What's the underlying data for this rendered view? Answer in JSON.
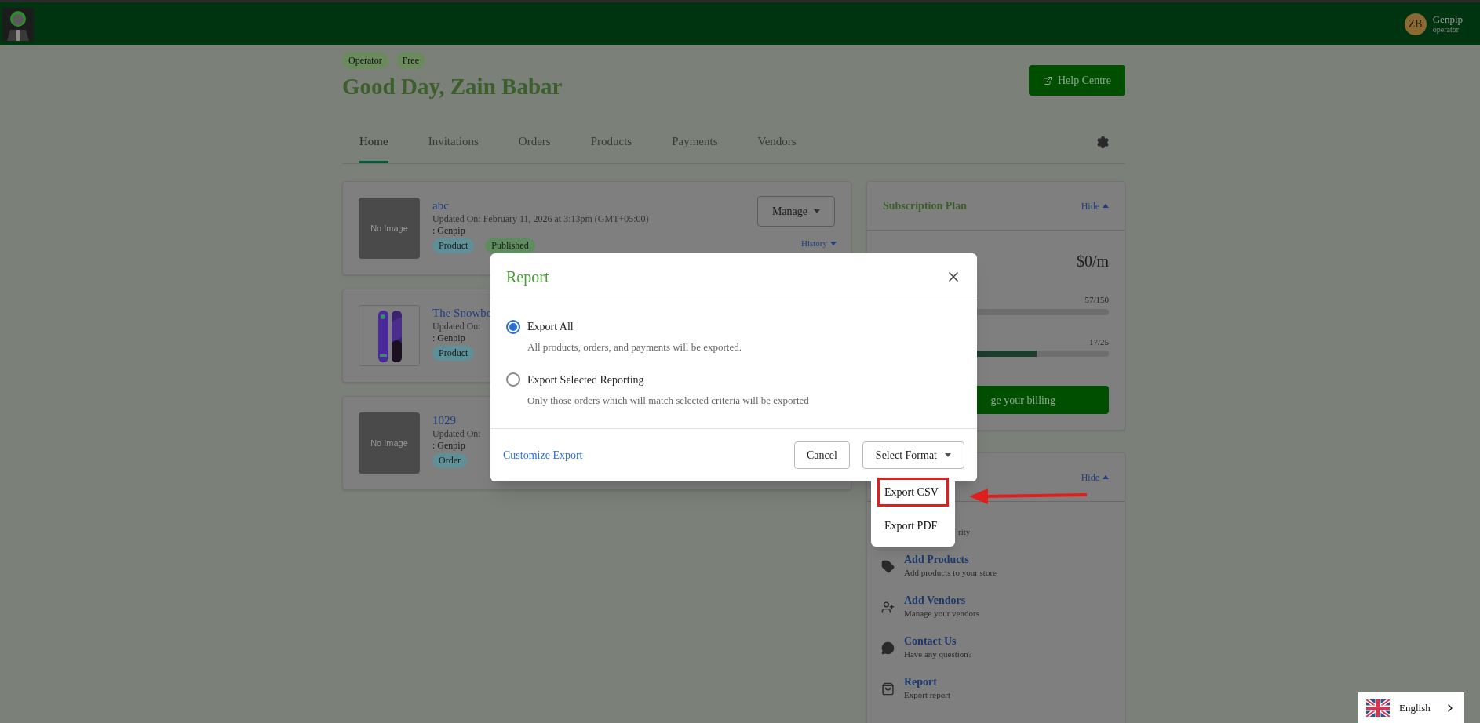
{
  "header": {
    "user": {
      "initials": "ZB",
      "name": "Genpip",
      "role": "operator"
    }
  },
  "page": {
    "badges": [
      "Operator",
      "Free"
    ],
    "greeting": "Good Day, Zain Babar",
    "help_button": "Help Centre"
  },
  "tabs": [
    {
      "label": "Home",
      "selected": true
    },
    {
      "label": "Invitations",
      "selected": false
    },
    {
      "label": "Orders",
      "selected": false
    },
    {
      "label": "Products",
      "selected": false
    },
    {
      "label": "Payments",
      "selected": false
    },
    {
      "label": "Vendors",
      "selected": false
    }
  ],
  "cards": [
    {
      "image": {
        "kind": "placeholder",
        "label": "No Image"
      },
      "title": "abc",
      "updated": "Updated On: February 11, 2026 at 3:13pm (GMT+05:00)",
      "owner": ": Genpip",
      "tags": [
        {
          "label": "Product",
          "kind": "type"
        },
        {
          "label": "Published",
          "kind": "status"
        }
      ],
      "manage_button": "Manage",
      "history_link": "History"
    },
    {
      "image": {
        "kind": "picture"
      },
      "title": "The Snowbo",
      "updated": "Updated On:",
      "owner": ": Genpip",
      "tags": [
        {
          "label": "Product",
          "kind": "type"
        }
      ]
    },
    {
      "image": {
        "kind": "placeholder",
        "label": "No Image"
      },
      "title": "1029",
      "updated": "Updated On:",
      "owner": ": Genpip",
      "tags": [
        {
          "label": "Order",
          "kind": "type"
        }
      ]
    }
  ],
  "subscription": {
    "title": "Subscription Plan",
    "toggle": "Hide",
    "price": "$0/m",
    "usage": [
      {
        "reading": "57/150"
      },
      {
        "reading": "17/25",
        "level": 0.68
      }
    ],
    "billing_button": "ge your billing"
  },
  "quick_actions": {
    "toggle": "Hide",
    "items": [
      {
        "subtitle": "rity"
      },
      {
        "kind": "tag",
        "title": "Add Products",
        "subtitle": "Add products to your store"
      },
      {
        "kind": "user",
        "title": "Add Vendors",
        "subtitle": "Manage your vendors"
      },
      {
        "kind": "chat",
        "title": "Contact Us",
        "subtitle": "Have any question?"
      },
      {
        "kind": "bag",
        "title": "Report",
        "subtitle": "Export report"
      }
    ]
  },
  "modal": {
    "title": "Report",
    "options": [
      {
        "label": "Export All",
        "description": "All products, orders, and payments will be exported.",
        "selected": true
      },
      {
        "label": "Export Selected Reporting",
        "description": "Only those orders which will match selected criteria will be exported",
        "selected": false
      }
    ],
    "link": "Customize Export",
    "cancel": "Cancel",
    "format_button": "Select Format",
    "menu": [
      {
        "label": "Export CSV",
        "highlighted": true
      },
      {
        "label": "Export PDF",
        "highlighted": false
      }
    ]
  },
  "language": {
    "label": "English"
  }
}
